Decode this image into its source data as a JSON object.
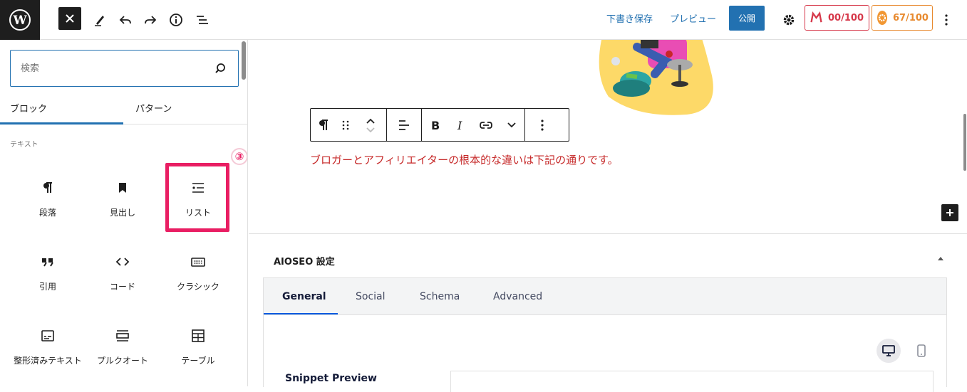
{
  "topbar": {
    "save_draft": "下書き保存",
    "preview": "プレビュー",
    "publish": "公開",
    "seo_score": "00/100",
    "truseo_score": "67/100"
  },
  "inserter": {
    "search_placeholder": "検索",
    "tabs": [
      "ブロック",
      "パターン"
    ],
    "section": "テキスト",
    "blocks": [
      {
        "label": "段落",
        "icon": "paragraph-icon"
      },
      {
        "label": "見出し",
        "icon": "heading-bookmark-icon"
      },
      {
        "label": "リスト",
        "icon": "list-icon"
      },
      {
        "label": "引用",
        "icon": "quote-icon"
      },
      {
        "label": "コード",
        "icon": "code-icon"
      },
      {
        "label": "クラシック",
        "icon": "keyboard-icon"
      },
      {
        "label": "整形済みテキスト",
        "icon": "preformatted-icon"
      },
      {
        "label": "プルクオート",
        "icon": "pullquote-icon"
      },
      {
        "label": "テーブル",
        "icon": "table-icon"
      }
    ],
    "step_badge": "③"
  },
  "editor": {
    "paragraph": "ブロガーとアフィリエイターの根本的な違いは下記の通りです。"
  },
  "aioseo": {
    "title": "AIOSEO 設定",
    "tabs": [
      "General",
      "Social",
      "Schema",
      "Advanced"
    ],
    "snippet_label": "Snippet Preview"
  },
  "colors": {
    "accent": "#2271b1",
    "highlight": "#e91e63",
    "paragraph_text": "#c62828",
    "seo_red": "#d6384a",
    "seo_orange": "#e88a2f"
  }
}
